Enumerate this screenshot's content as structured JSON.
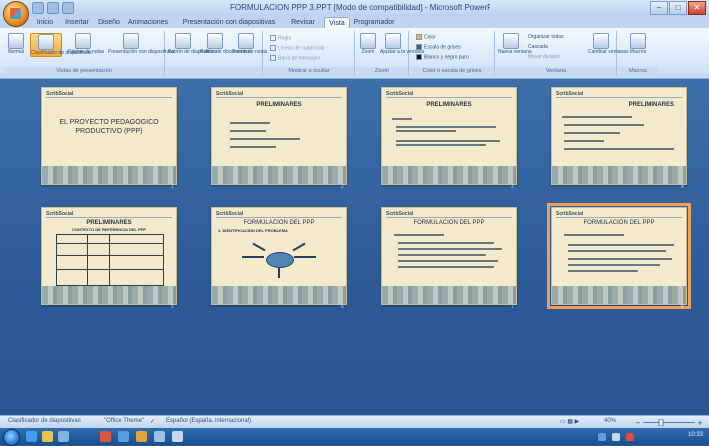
{
  "window": {
    "title": "FORMULACION PPP 3.PPT [Modo de compatibilidad] - Microsoft PowerPoint",
    "min": "–",
    "max": "□",
    "close": "✕"
  },
  "tabs": [
    "Inicio",
    "Insertar",
    "Diseño",
    "Animaciones",
    "Presentación con diapositivas",
    "Revisar",
    "Vista",
    "Programador"
  ],
  "active_tab": "Vista",
  "ribbon": {
    "groups": [
      {
        "label": "Vistas de presentación",
        "buttons": [
          "Normal",
          "Clasificador de diapositivas",
          "Página de notas",
          "Presentación con diapositivas"
        ]
      },
      {
        "label": "",
        "buttons": [
          "Patrón de diapositivas",
          "Patrón de documentos",
          "Patrón de notas"
        ]
      },
      {
        "label": "Mostrar u ocultar",
        "items": [
          "Regla",
          "Líneas de cuadrícula",
          "Barra de mensajes"
        ]
      },
      {
        "label": "Zoom",
        "buttons": [
          "Zoom",
          "Ajustar a la ventana"
        ]
      },
      {
        "label": "Color o escala de grises",
        "items": [
          "Color",
          "Escala de grises",
          "Blanco y negro puro"
        ]
      },
      {
        "label": "Ventana",
        "buttons": [
          "Nueva ventana",
          "Organizar todas",
          "Cascada",
          "Mover división",
          "Cambiar ventanas"
        ]
      },
      {
        "label": "Macros",
        "buttons": [
          "Macros"
        ]
      }
    ]
  },
  "slides": [
    {
      "num": "1",
      "header": "ScribSocial",
      "title": "EL PROYECTO PEDAGOGICO PRODUCTIVO (PPP)"
    },
    {
      "num": "2",
      "header": "ScribSocial",
      "title": "PRELIMINARES"
    },
    {
      "num": "3",
      "header": "ScribSocial",
      "title": "PRELIMINARES"
    },
    {
      "num": "4",
      "header": "ScribSocial",
      "title": "PRELIMINARES"
    },
    {
      "num": "5",
      "header": "ScribSocial",
      "title": "PRELIMINARES",
      "subtitle": "CONTEXTO DE REFERENCIA DEL PPP"
    },
    {
      "num": "6",
      "header": "ScribSocial",
      "title": "FORMULACION DEL PPP",
      "subtitle": "1. IDENTIFICACIÓN DEL PROBLEMA"
    },
    {
      "num": "7",
      "header": "ScribSocial",
      "title": "FORMULACION DEL PPP"
    },
    {
      "num": "8",
      "header": "ScribSocial",
      "title": "FORMULACION DEL PPP"
    }
  ],
  "selected_slide": "8",
  "statusbar": {
    "view": "Clasificador de diapositivas",
    "theme": "\"Office Theme\"",
    "language": "Español (España, internacional)",
    "zoom": "40%"
  },
  "taskbar": {
    "clock": "10:33"
  },
  "colors": {
    "accent": "#f0a05a",
    "workspace": "#2e5c98",
    "slide_bg": "#f2eacb"
  }
}
